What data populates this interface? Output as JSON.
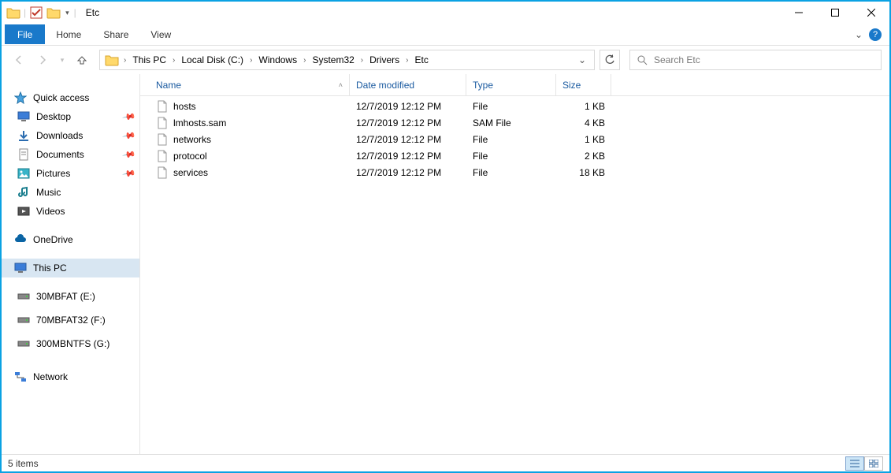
{
  "window": {
    "title": "Etc"
  },
  "ribbon": {
    "file": "File",
    "tabs": [
      "Home",
      "Share",
      "View"
    ]
  },
  "breadcrumb": {
    "items": [
      "This PC",
      "Local Disk (C:)",
      "Windows",
      "System32",
      "Drivers",
      "Etc"
    ]
  },
  "search": {
    "placeholder": "Search Etc"
  },
  "sidebar": {
    "quick_access": "Quick access",
    "qa_items": [
      {
        "label": "Desktop",
        "icon": "desktop",
        "pinned": true
      },
      {
        "label": "Downloads",
        "icon": "downloads",
        "pinned": true
      },
      {
        "label": "Documents",
        "icon": "documents",
        "pinned": true
      },
      {
        "label": "Pictures",
        "icon": "pictures",
        "pinned": true
      },
      {
        "label": "Music",
        "icon": "music",
        "pinned": false
      },
      {
        "label": "Videos",
        "icon": "videos",
        "pinned": false
      }
    ],
    "onedrive": "OneDrive",
    "thispc": "This PC",
    "drives": [
      {
        "label": "30MBFAT (E:)"
      },
      {
        "label": "70MBFAT32 (F:)"
      },
      {
        "label": "300MBNTFS (G:)"
      }
    ],
    "network": "Network"
  },
  "columns": {
    "name": "Name",
    "date": "Date modified",
    "type": "Type",
    "size": "Size"
  },
  "files": [
    {
      "name": "hosts",
      "date": "12/7/2019 12:12 PM",
      "type": "File",
      "size": "1 KB"
    },
    {
      "name": "lmhosts.sam",
      "date": "12/7/2019 12:12 PM",
      "type": "SAM File",
      "size": "4 KB"
    },
    {
      "name": "networks",
      "date": "12/7/2019 12:12 PM",
      "type": "File",
      "size": "1 KB"
    },
    {
      "name": "protocol",
      "date": "12/7/2019 12:12 PM",
      "type": "File",
      "size": "2 KB"
    },
    {
      "name": "services",
      "date": "12/7/2019 12:12 PM",
      "type": "File",
      "size": "18 KB"
    }
  ],
  "statusbar": {
    "count": "5 items"
  }
}
